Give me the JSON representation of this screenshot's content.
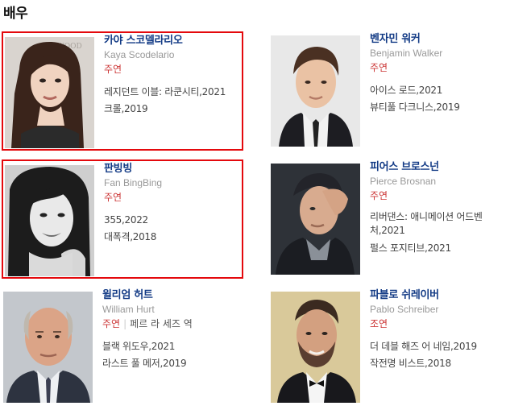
{
  "section": {
    "title": "배우"
  },
  "actors": [
    {
      "name": "카야 스코델라리오",
      "english_name": "Kaya Scodelario",
      "role": "주연",
      "character": "",
      "works": [
        "레지던트 이블: 라쿤시티,2021",
        "크롤,2019"
      ],
      "highlighted": true,
      "photo": "portrait-dark-long-hair"
    },
    {
      "name": "벤자민 워커",
      "english_name": "Benjamin Walker",
      "role": "주연",
      "character": "",
      "works": [
        "아이스 로드,2021",
        "뷰티풀 다크니스,2019"
      ],
      "highlighted": false,
      "photo": "portrait-man-suit"
    },
    {
      "name": "판빙빙",
      "english_name": "Fan BingBing",
      "role": "주연",
      "character": "",
      "works": [
        "355,2022",
        "대폭격,2018"
      ],
      "highlighted": true,
      "photo": "portrait-black-white-woman"
    },
    {
      "name": "피어스 브로스넌",
      "english_name": "Pierce Brosnan",
      "role": "주연",
      "character": "",
      "works": [
        "리버댄스: 애니메이션 어드벤처,2021",
        "펄스 포지티브,2021"
      ],
      "highlighted": false,
      "photo": "portrait-man-hand-on-head"
    },
    {
      "name": "윌리엄 허트",
      "english_name": "William Hurt",
      "role": "주연",
      "character": "페르 라 세즈 역",
      "works": [
        "블랙 위도우,2021",
        "라스트 풀 메저,2019"
      ],
      "highlighted": false,
      "photo": "portrait-bald-man"
    },
    {
      "name": "파블로 쉬레이버",
      "english_name": "Pablo Schreiber",
      "role": "조연",
      "character": "",
      "works": [
        "더 데블 해즈 어 네임,2019",
        "작전명 비스트,2018"
      ],
      "highlighted": false,
      "photo": "portrait-bearded-man-tuxedo"
    }
  ],
  "colors": {
    "name": "#123a85",
    "role": "#cc3535",
    "highlight_border": "#e4090d"
  }
}
